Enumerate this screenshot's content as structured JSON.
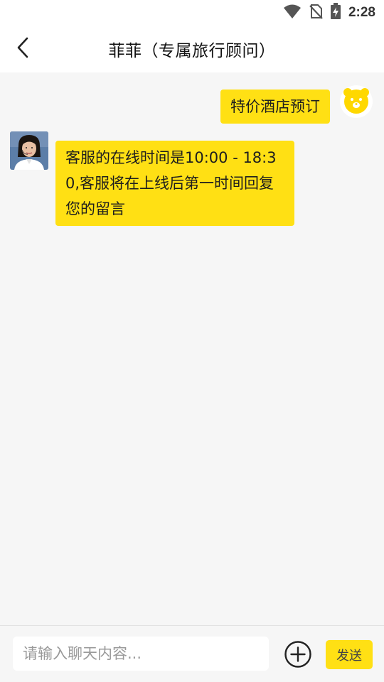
{
  "status_bar": {
    "time": "2:28",
    "icons": [
      "wifi-icon",
      "no-sim-icon",
      "battery-charging-icon"
    ]
  },
  "header": {
    "title": "菲菲（专属旅行顾问）",
    "back_icon": "chevron-left-icon"
  },
  "messages": [
    {
      "from": "user",
      "text": "特价酒店预订",
      "avatar": "bear-avatar"
    },
    {
      "from": "agent",
      "text": "客服的在线时间是10:00 - 18:30,客服将在上线后第一时间回复您的留言",
      "avatar": "agent-photo"
    }
  ],
  "input": {
    "placeholder": "请输入聊天内容...",
    "value": "",
    "plus_icon": "plus-circle-icon",
    "send_label": "发送"
  },
  "colors": {
    "bubble": "#ffe014",
    "background": "#f6f6f6",
    "header": "#ffffff"
  }
}
